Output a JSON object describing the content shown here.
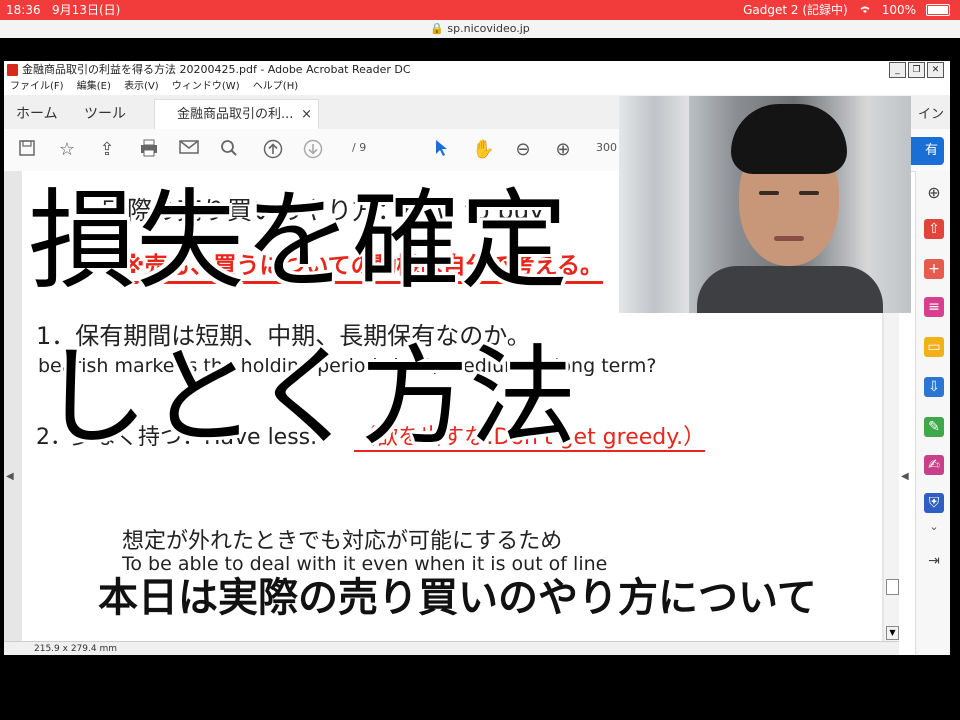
{
  "status_bar": {
    "time": "18:36",
    "date": "9月13日(日)",
    "right_label": "Gadget 2 (記録中)",
    "battery": "100%",
    "color": "#f23b3b"
  },
  "browser": {
    "url": "sp.nicovideo.jp"
  },
  "acrobat": {
    "window_title": "金融商品取引の利益を得る方法 20200425.pdf - Adobe Acrobat Reader DC",
    "menu": [
      "ファイル(F)",
      "編集(E)",
      "表示(V)",
      "ウィンドウ(W)",
      "ヘルプ(H)"
    ],
    "tabs": {
      "home": "ホーム",
      "tools": "ツール",
      "doc": "金融商品取引の利...",
      "close": "×",
      "signin": "イン"
    },
    "toolbar": {
      "page_count": "/ 9",
      "zoom": "300",
      "share": "有"
    },
    "page_size": "215.9 x 279.4 mm",
    "document": {
      "heading": "実際の売り買いのやり方：How to buy",
      "note": "※売る、買うについての動機は自分で考える。",
      "line1": "1．保有期間は短期、中期、長期保有なのか。",
      "line2": "bearish marketIs the holding period short, medium or long term?",
      "line3": "2．少なく持つ：Have less.",
      "line3_red": "（欲を出すな:Don't get greedy.）",
      "line4": "想定が外れたときでも対応が可能にするため",
      "line5": "To be able to deal with it even when it is out of line"
    }
  },
  "overlay": {
    "caption_line1": "損失を確定",
    "caption_line2": "しとく方法",
    "subtitle": "本日は実際の売り買いのやり方について"
  },
  "icons": [
    "pdf-app-icon",
    "save-icon",
    "star-icon",
    "upload-icon",
    "print-icon",
    "mail-icon",
    "search-icon",
    "page-up-icon",
    "page-down-icon",
    "cursor-icon",
    "hand-icon",
    "zoom-out-icon",
    "zoom-in-icon",
    "sidebar-zoom-icon",
    "export-pdf-icon",
    "create-pdf-icon",
    "organize-icon",
    "comment-icon",
    "compress-icon",
    "edit-pdf-icon",
    "sign-icon",
    "protect-icon",
    "collapse-icon"
  ]
}
